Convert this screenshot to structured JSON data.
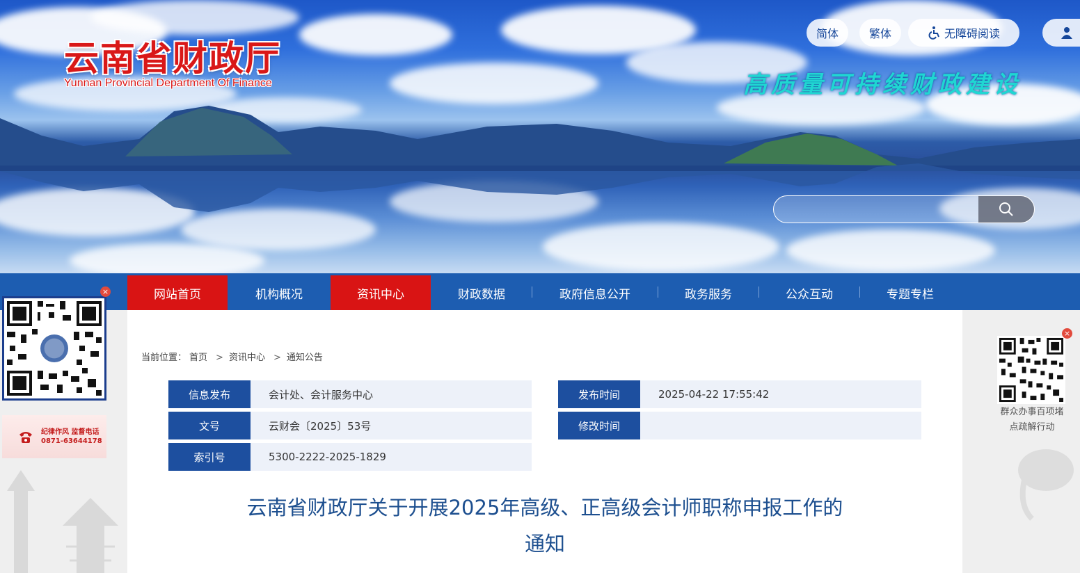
{
  "header": {
    "title": "云南省财政厅",
    "subtitle": "Yunnan Provincial Department Of Finance",
    "slogan": "高质量可持续财政建设",
    "toolbar": {
      "simplified": "简体",
      "traditional": "繁体",
      "accessibility": "无障碍阅读"
    },
    "search": {
      "placeholder": ""
    }
  },
  "nav": {
    "items": [
      {
        "label": "网站首页",
        "active": true
      },
      {
        "label": "机构概况",
        "active": false
      },
      {
        "label": "资讯中心",
        "active": true
      },
      {
        "label": "财政数据",
        "active": false
      },
      {
        "label": "政府信息公开",
        "active": false
      },
      {
        "label": "政务服务",
        "active": false
      },
      {
        "label": "公众互动",
        "active": false
      },
      {
        "label": "专题专栏",
        "active": false
      }
    ]
  },
  "breadcrumb": {
    "prefix": "当前位置：",
    "items": [
      "首页",
      "资讯中心",
      "通知公告"
    ],
    "separator": ">"
  },
  "meta": {
    "publisher_label": "信息发布",
    "publisher": "会计处、会计服务中心",
    "doc_no_label": "文号",
    "doc_no": "云财会〔2025〕53号",
    "index_label": "索引号",
    "index": "5300-2222-2025-1829",
    "publish_time_label": "发布时间",
    "publish_time": "2025-04-22 17:55:42",
    "modify_time_label": "修改时间",
    "modify_time": ""
  },
  "article": {
    "title_line1": "云南省财政厅关于开展2025年高级、正高级会计师职称申报工作的",
    "title_line2": "通知"
  },
  "side": {
    "hotline_line1": "纪律作风 监督电话",
    "hotline_line2": "0871-63644178",
    "right_caption_line1": "群众办事百项堵",
    "right_caption_line2": "点疏解行动",
    "close_glyph": "×"
  },
  "colors": {
    "nav_bg": "#1d5db1",
    "nav_active": "#d91414",
    "label_bg": "#1d4f9f",
    "title_blue": "#1d4f8f",
    "brand_red": "#d91818"
  }
}
